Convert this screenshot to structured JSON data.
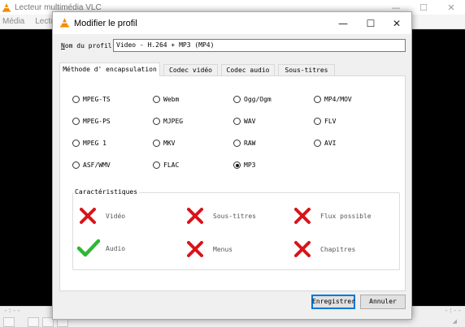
{
  "vlc": {
    "title": "Lecteur multimédia VLC",
    "menus": [
      "Média",
      "Lectur"
    ],
    "time_left": "-:--",
    "time_right": "-:--",
    "window_controls": {
      "minimize": "—",
      "maximize": "☐",
      "close": "✕"
    }
  },
  "dialog": {
    "title": "Modifier le profil",
    "controls": {
      "minimize": "—",
      "maximize": "☐",
      "close": "✕"
    },
    "profile": {
      "label": "Nom du profil",
      "label_underline_char": "N",
      "label_rest": "om du profil",
      "value": "Video - H.264 + MP3 (MP4)"
    },
    "tabs": [
      {
        "label": "Méthode d' encapsulation",
        "active": true
      },
      {
        "label": "Codec vidéo",
        "active": false
      },
      {
        "label": "Codec audio",
        "active": false
      },
      {
        "label": "Sous-titres",
        "active": false
      }
    ],
    "encapsulation": [
      {
        "label": "MPEG-TS",
        "checked": false
      },
      {
        "label": "Webm",
        "checked": false
      },
      {
        "label": "Ogg/Ogm",
        "checked": false
      },
      {
        "label": "MP4/MOV",
        "checked": false
      },
      {
        "label": "MPEG-PS",
        "checked": false
      },
      {
        "label": "MJPEG",
        "checked": false
      },
      {
        "label": "WAV",
        "checked": false
      },
      {
        "label": "FLV",
        "checked": false
      },
      {
        "label": "MPEG 1",
        "checked": false
      },
      {
        "label": "MKV",
        "checked": false
      },
      {
        "label": "RAW",
        "checked": false
      },
      {
        "label": "AVI",
        "checked": false
      },
      {
        "label": "ASF/WMV",
        "checked": false
      },
      {
        "label": "FLAC",
        "checked": false
      },
      {
        "label": "MP3",
        "checked": true
      }
    ],
    "features_title": "Caractéristiques",
    "features": [
      {
        "label": "Vidéo",
        "supported": false
      },
      {
        "label": "Sous-titres",
        "supported": false
      },
      {
        "label": "Flux possible",
        "supported": false
      },
      {
        "label": "Audio",
        "supported": true
      },
      {
        "label": "Menus",
        "supported": false
      },
      {
        "label": "Chapitres",
        "supported": false
      }
    ],
    "buttons": {
      "save": "Enregistrer",
      "cancel": "Annuler"
    }
  },
  "colors": {
    "cross": "#d8141a",
    "check": "#2db832",
    "accent": "#0078d7",
    "vlc_orange": "#f08a00"
  },
  "icons": {
    "app": "vlc-cone-icon",
    "supported": "check-icon",
    "unsupported": "cross-icon"
  }
}
